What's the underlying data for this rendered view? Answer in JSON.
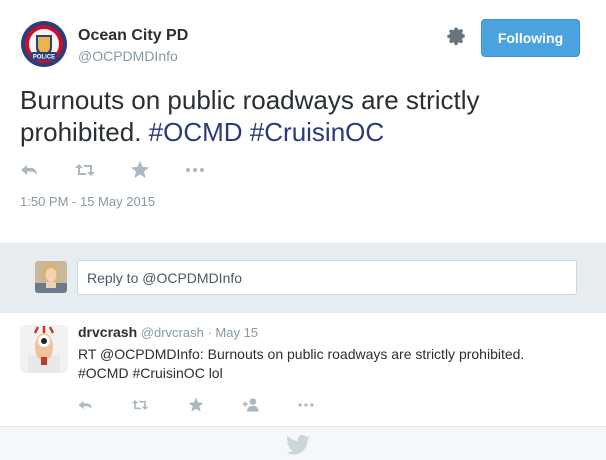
{
  "author": {
    "name": "Ocean City PD",
    "handle": "@OCPDMDInfo",
    "avatar_badge_text": "POLICE"
  },
  "follow_button": {
    "label": "Following"
  },
  "tweet": {
    "text_plain": "Burnouts on public roadways are strictly prohibited.",
    "hashtags": [
      "#OCMD",
      "#CruisinOC"
    ],
    "timestamp": "1:50 PM - 15 May 2015",
    "actions": [
      "reply-icon",
      "retweet-icon",
      "favorite-icon",
      "more-icon"
    ]
  },
  "reply": {
    "placeholder": "Reply to @OCPDMDInfo"
  },
  "replies": [
    {
      "name": "drvcrash",
      "handle": "@drvcrash",
      "separator": "·",
      "date": "May 15",
      "text_line1": "RT @OCPDMDInfo: Burnouts on public roadways are strictly prohibited.",
      "text_line2": "#OCMD #CruisinOC  lol",
      "actions": [
        "reply-icon",
        "retweet-icon",
        "favorite-icon",
        "follow-icon",
        "more-icon"
      ]
    }
  ],
  "colors": {
    "accent": "#4aa3df",
    "hashtag": "#2b3a7a",
    "muted": "#8899a6",
    "icon": "#aab8c2"
  }
}
